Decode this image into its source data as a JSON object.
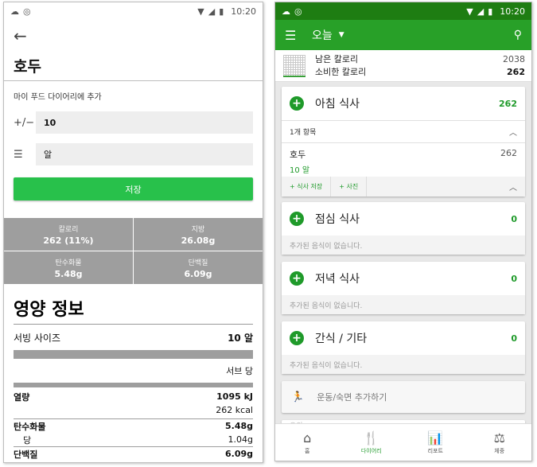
{
  "left": {
    "status_time": "10:20",
    "food_title": "호두",
    "add_to_diary": "마이 푸드 다이어리에 추가",
    "quantity_icon": "+/−",
    "quantity_value": "10",
    "unit_value": "알",
    "save_label": "저장",
    "summary": [
      {
        "label": "칼로리",
        "value": "262 (11%)"
      },
      {
        "label": "지방",
        "value": "26.08g"
      },
      {
        "label": "탄수화물",
        "value": "5.48g"
      },
      {
        "label": "단백질",
        "value": "6.09g"
      }
    ],
    "nutrition_title": "영양 정보",
    "serving_label": "서빙 사이즈",
    "serving_value": "10 알",
    "per_label": "서브 당",
    "energy_label": "열량",
    "energy_kj": "1095 kJ",
    "energy_kcal": "262 kcal",
    "carb_label": "탄수화물",
    "carb_value": "5.48g",
    "sugar_label": "당",
    "sugar_value": "1.04g",
    "protein_label": "단백질",
    "protein_value": "6.09g"
  },
  "right": {
    "status_time": "10:20",
    "toolbar_title": "오늘",
    "remaining_label": "남은 칼로리",
    "remaining_value": "2038",
    "consumed_label": "소비한 칼로리",
    "consumed_value": "262",
    "breakfast": {
      "name": "아침 식사",
      "calories": "262",
      "items_label": "1개 항목",
      "entry_name": "호두",
      "entry_qty": "10 알",
      "entry_cal": "262",
      "add_meal": "+ 식사 저장",
      "add_photo": "+ 사진"
    },
    "lunch": {
      "name": "점심 식사",
      "calories": "0",
      "empty": "추가된 음식이 없습니다."
    },
    "dinner": {
      "name": "저녁 식사",
      "calories": "0",
      "empty": "추가된 음식이 없습니다."
    },
    "snack": {
      "name": "간식 / 기타",
      "calories": "0",
      "empty": "추가된 음식이 없습니다."
    },
    "exercise_label": "운동/숙면 추가하기",
    "partial_label": "오의",
    "nav": [
      {
        "label": "홈",
        "icon": "home-icon"
      },
      {
        "label": "다이어리",
        "icon": "fork-knife-icon"
      },
      {
        "label": "리포트",
        "icon": "chart-icon"
      },
      {
        "label": "체중",
        "icon": "scale-icon"
      }
    ]
  },
  "colors": {
    "accent_green": "#28c14b",
    "toolbar_green": "#28a028",
    "statusbar_green": "#1e7d12",
    "summary_gray": "#9e9e9e"
  }
}
